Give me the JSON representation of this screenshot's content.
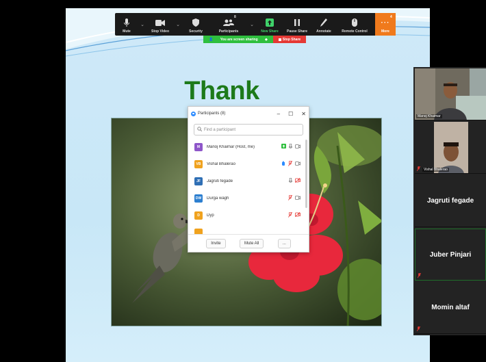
{
  "toolbar": {
    "mute": "Mute",
    "stop_video": "Stop Video",
    "security": "Security",
    "participants": "Participants",
    "participants_count": "8",
    "new_share": "New Share",
    "pause_share": "Pause Share",
    "annotate": "Annotate",
    "remote_control": "Remote Control",
    "more": "More",
    "more_badge": "4"
  },
  "share_bar": {
    "status": "You are screen sharing",
    "stop": "Stop Share"
  },
  "slide": {
    "title": "Thank you"
  },
  "participants_panel": {
    "title": "Participants (8)",
    "search_placeholder": "Find a participant",
    "rows": [
      {
        "initials": "M",
        "name": "Manoj Khaimar (Host, me)",
        "color": "#8e56c9"
      },
      {
        "initials": "VB",
        "name": "Vishal Bhalerao",
        "color": "#f0a21e"
      },
      {
        "initials": "JF",
        "name": "Jagruti fegade",
        "color": "#2f6fb5"
      },
      {
        "initials": "DW",
        "name": "Durga wagh",
        "color": "#2d7fd0"
      },
      {
        "initials": "D",
        "name": "Dyp",
        "color": "#f0a21e"
      },
      {
        "initials": "",
        "name": "",
        "color": "#f0a21e"
      }
    ],
    "invite": "Invite",
    "mute_all": "Mute All",
    "more": "..."
  },
  "gallery": {
    "tiles": [
      {
        "name": "Manoj Khaimar"
      },
      {
        "name": "Vishal Bhalerao"
      },
      {
        "name": "Jagruti fegade"
      },
      {
        "name": "Juber Pinjari"
      },
      {
        "name": "Momin altaf"
      }
    ]
  },
  "colors": {
    "accent_green": "#2fbf3e",
    "stop_red": "#e53935",
    "more_orange": "#f07a1c",
    "muted_red": "#e53935",
    "zoom_blue": "#2d8cff"
  }
}
